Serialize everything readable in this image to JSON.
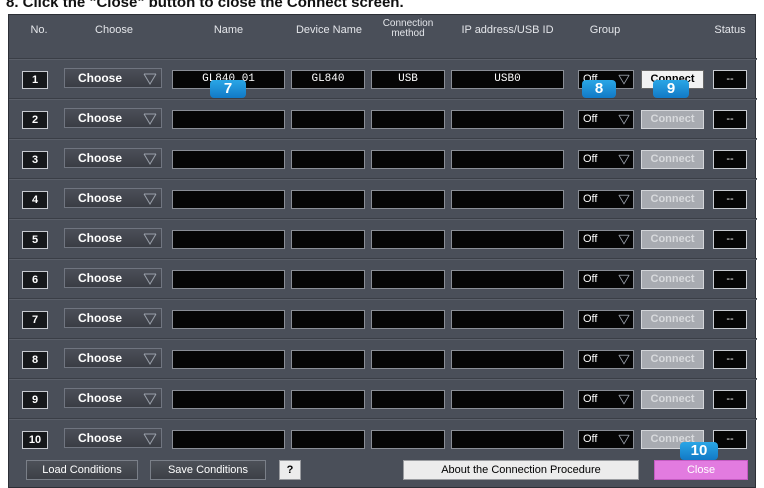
{
  "caption": "8.  Click the \"Close\" button to close the Connect screen.",
  "headers": {
    "no": "No.",
    "choose": "Choose",
    "name": "Name",
    "device_name": "Device Name",
    "connection_line1": "Connection",
    "connection_line2": "method",
    "ip": "IP address/USB ID",
    "group": "Group",
    "status": "Status"
  },
  "rows": [
    {
      "no": "1",
      "choose": "Choose",
      "name": "GL840 01",
      "device": "GL840",
      "conn": "USB",
      "ip": "USB0",
      "group": "Off",
      "connect": "Connect",
      "status": "--"
    },
    {
      "no": "2",
      "choose": "Choose",
      "name": "",
      "device": "",
      "conn": "",
      "ip": "",
      "group": "Off",
      "connect": "Connect",
      "status": "--"
    },
    {
      "no": "3",
      "choose": "Choose",
      "name": "",
      "device": "",
      "conn": "",
      "ip": "",
      "group": "Off",
      "connect": "Connect",
      "status": "--"
    },
    {
      "no": "4",
      "choose": "Choose",
      "name": "",
      "device": "",
      "conn": "",
      "ip": "",
      "group": "Off",
      "connect": "Connect",
      "status": "--"
    },
    {
      "no": "5",
      "choose": "Choose",
      "name": "",
      "device": "",
      "conn": "",
      "ip": "",
      "group": "Off",
      "connect": "Connect",
      "status": "--"
    },
    {
      "no": "6",
      "choose": "Choose",
      "name": "",
      "device": "",
      "conn": "",
      "ip": "",
      "group": "Off",
      "connect": "Connect",
      "status": "--"
    },
    {
      "no": "7",
      "choose": "Choose",
      "name": "",
      "device": "",
      "conn": "",
      "ip": "",
      "group": "Off",
      "connect": "Connect",
      "status": "--"
    },
    {
      "no": "8",
      "choose": "Choose",
      "name": "",
      "device": "",
      "conn": "",
      "ip": "",
      "group": "Off",
      "connect": "Connect",
      "status": "--"
    },
    {
      "no": "9",
      "choose": "Choose",
      "name": "",
      "device": "",
      "conn": "",
      "ip": "",
      "group": "Off",
      "connect": "Connect",
      "status": "--"
    },
    {
      "no": "10",
      "choose": "Choose",
      "name": "",
      "device": "",
      "conn": "",
      "ip": "",
      "group": "Off",
      "connect": "Connect",
      "status": "--"
    }
  ],
  "badges": {
    "b7": "7",
    "b8": "8",
    "b9": "9",
    "b10": "10"
  },
  "footer": {
    "load": "Load Conditions",
    "save": "Save Conditions",
    "help": "?",
    "about": "About the Connection Procedure",
    "close": "Close"
  },
  "colors": {
    "panel": "#4a4f59",
    "badge": "#1e8fd8",
    "close": "#e27be0"
  }
}
